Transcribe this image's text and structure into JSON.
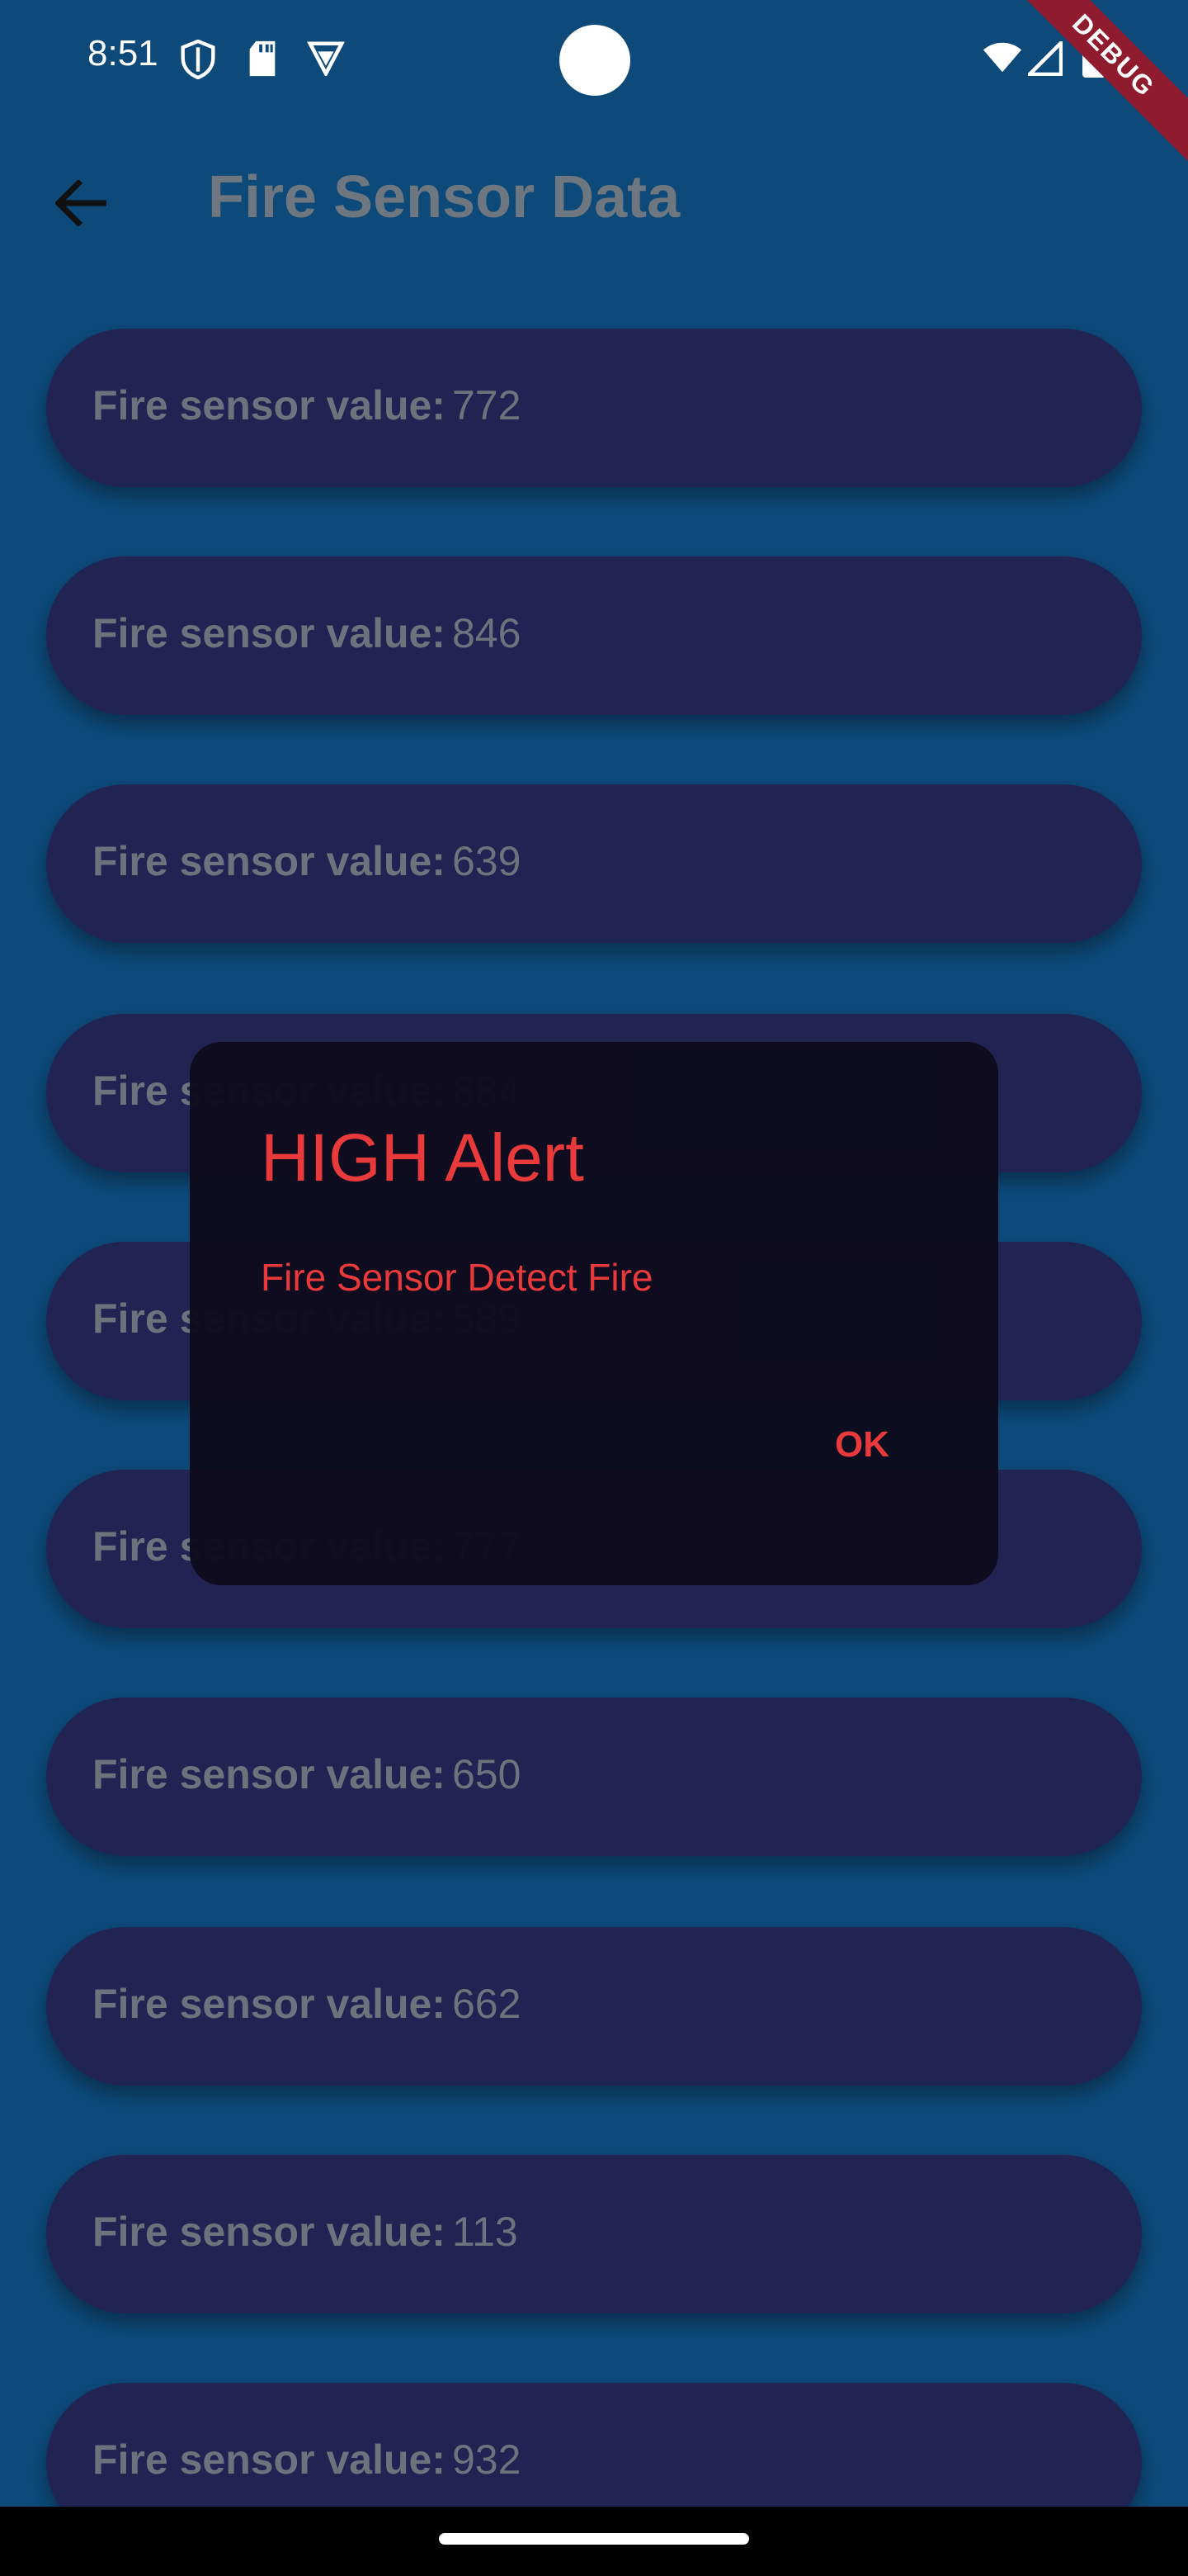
{
  "status_bar": {
    "time": "8:51",
    "icons_left": [
      "shield-icon",
      "sd-card-icon",
      "vpn-icon"
    ],
    "icons_right": [
      "wifi-icon",
      "signal-icon",
      "battery-icon"
    ],
    "debug_label": "DEBUG"
  },
  "app_bar": {
    "back_icon": "arrow-left-icon",
    "title": "Fire Sensor Data"
  },
  "list": {
    "label": "Fire sensor value:",
    "items": [
      {
        "value": "772"
      },
      {
        "value": "846"
      },
      {
        "value": "639"
      },
      {
        "value": "884"
      },
      {
        "value": "589"
      },
      {
        "value": "777"
      },
      {
        "value": "650"
      },
      {
        "value": "662"
      },
      {
        "value": "113"
      },
      {
        "value": "932"
      }
    ]
  },
  "dialog": {
    "title": "HIGH Alert",
    "message": "Fire Sensor Detect Fire",
    "ok_label": "OK"
  },
  "colors": {
    "background": "#0d4a7a",
    "card": "#212352",
    "alert_red": "#e8393b",
    "dialog_bg": "#0d0b1d"
  }
}
